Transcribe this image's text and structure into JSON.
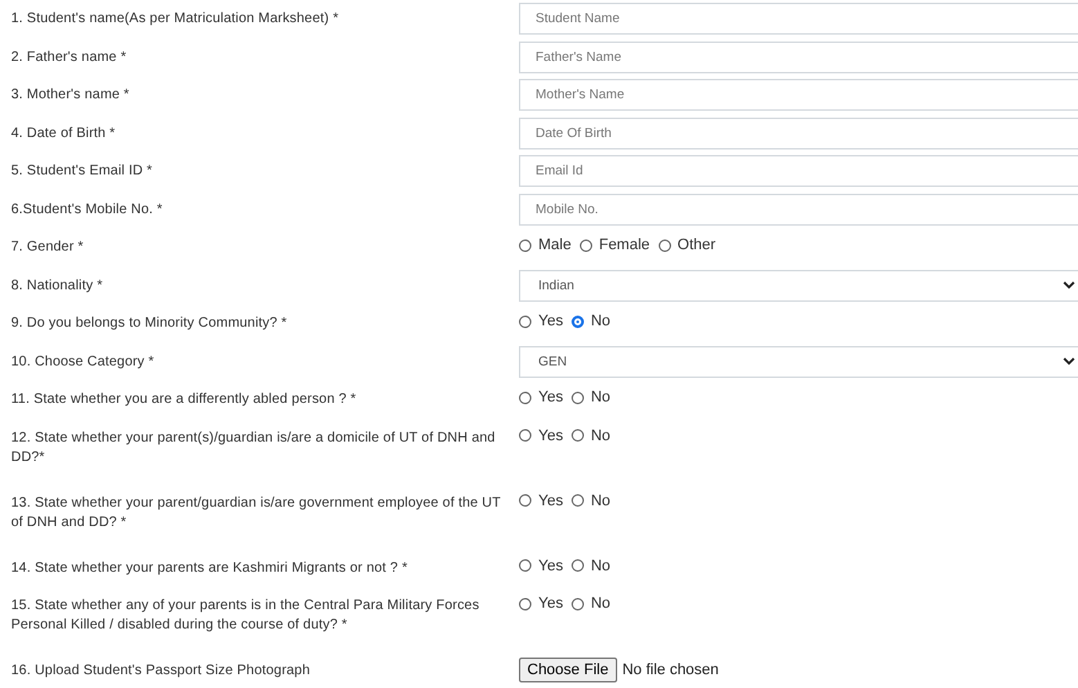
{
  "fields": [
    {
      "label": "1. Student's name(As per Matriculation Marksheet) *",
      "kind": "text",
      "placeholder": "Student Name"
    },
    {
      "label": "2. Father's name *",
      "kind": "text",
      "placeholder": "Father's Name"
    },
    {
      "label": "3. Mother's name *",
      "kind": "text",
      "placeholder": "Mother's Name"
    },
    {
      "label": "4. Date of Birth *",
      "kind": "text",
      "placeholder": "Date Of Birth"
    },
    {
      "label": "5. Student's Email ID *",
      "kind": "text",
      "placeholder": "Email Id"
    },
    {
      "label": "6.Student's Mobile No. *",
      "kind": "text",
      "placeholder": "Mobile No."
    },
    {
      "label": "7. Gender *",
      "kind": "radio",
      "options": [
        {
          "label": "Male",
          "selected": false
        },
        {
          "label": "Female",
          "selected": false
        },
        {
          "label": "Other",
          "selected": false
        }
      ]
    },
    {
      "label": "8. Nationality *",
      "kind": "select",
      "value": "Indian"
    },
    {
      "label": "9. Do you belongs to Minority Community? *",
      "kind": "radio",
      "options": [
        {
          "label": "Yes",
          "selected": false
        },
        {
          "label": "No",
          "selected": true
        }
      ]
    },
    {
      "label": "10. Choose Category *",
      "kind": "select",
      "value": "GEN"
    },
    {
      "label": "11.  State whether you are a differently abled person ? *",
      "kind": "radio",
      "options": [
        {
          "label": "Yes",
          "selected": false
        },
        {
          "label": "No",
          "selected": false
        }
      ]
    },
    {
      "label": "12. State whether your parent(s)/guardian is/are a domicile of UT of DNH and DD?*",
      "kind": "radio",
      "options": [
        {
          "label": "Yes",
          "selected": false
        },
        {
          "label": "No",
          "selected": false
        }
      ]
    },
    {
      "label": "13. State whether your parent/guardian is/are government employee of the UT of DNH and DD? *",
      "kind": "radio",
      "options": [
        {
          "label": "Yes",
          "selected": false
        },
        {
          "label": "No",
          "selected": false
        }
      ]
    },
    {
      "label": "14. State whether your parents are Kashmiri Migrants or not ? *",
      "kind": "radio",
      "options": [
        {
          "label": "Yes",
          "selected": false
        },
        {
          "label": "No",
          "selected": false
        }
      ]
    },
    {
      "label": "15.  State whether any of your parents is in the Central Para Military Forces Personal Killed / disabled during the course of duty? *",
      "kind": "radio",
      "options": [
        {
          "label": "Yes",
          "selected": false
        },
        {
          "label": "No",
          "selected": false
        }
      ]
    },
    {
      "label": "16. Upload Student's Passport Size Photograph",
      "kind": "file",
      "button": "Choose File",
      "status": "No file chosen"
    }
  ]
}
